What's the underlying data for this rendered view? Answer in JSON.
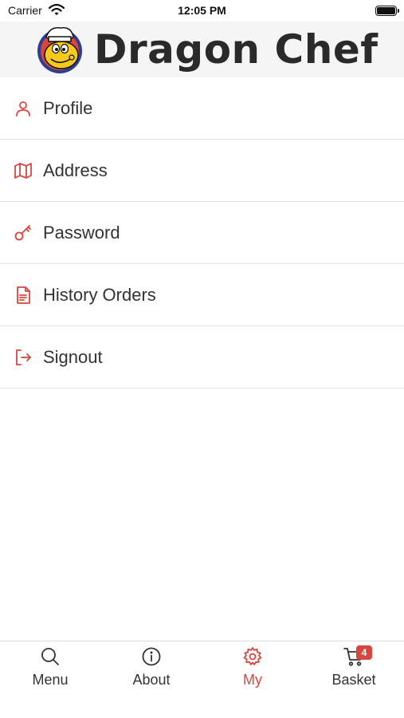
{
  "status_bar": {
    "carrier": "Carrier",
    "time": "12:05 PM"
  },
  "header": {
    "brand_name": "Dragon Chef",
    "logo_icon": "dragon-chef-mascot"
  },
  "menu": {
    "items": [
      {
        "label": "Profile",
        "icon": "user-icon"
      },
      {
        "label": "Address",
        "icon": "map-icon"
      },
      {
        "label": "Password",
        "icon": "key-icon"
      },
      {
        "label": "History Orders",
        "icon": "document-icon"
      },
      {
        "label": "Signout",
        "icon": "signout-icon"
      }
    ]
  },
  "tab_bar": {
    "tabs": [
      {
        "label": "Menu",
        "icon": "search-icon"
      },
      {
        "label": "About",
        "icon": "info-icon"
      },
      {
        "label": "My",
        "icon": "gear-icon",
        "active": true
      },
      {
        "label": "Basket",
        "icon": "cart-icon"
      }
    ],
    "basket_badge": "4"
  },
  "colors": {
    "accent": "#d9463f",
    "header_bg": "#f5f5f5",
    "text": "#333333"
  }
}
